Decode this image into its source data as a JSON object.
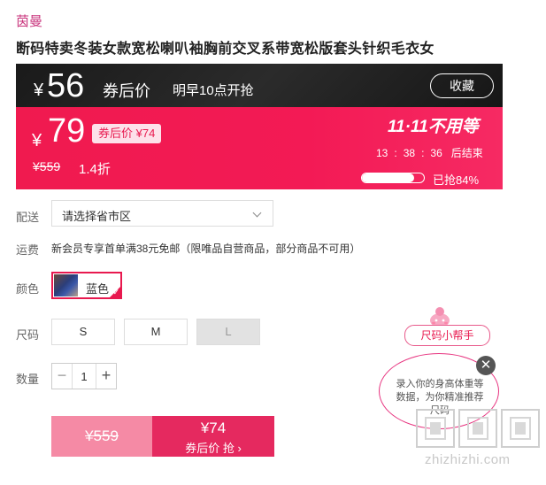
{
  "product": {
    "brand": "茵曼",
    "title": "断码特卖冬装女款宽松喇叭袖胸前交叉系带宽松版套头针织毛衣女"
  },
  "promo": {
    "currency": "¥",
    "coupon_price": "56",
    "coupon_price_label": "券后价",
    "sale_note": "明早10点开抢",
    "favorite_label": "收藏",
    "original_price_value": "79",
    "coupon_tag": "券后价 ¥74",
    "list_price": "¥559",
    "discount": "1.4折",
    "event_title": "11·11不用等",
    "countdown": {
      "h": "13",
      "m": "38",
      "s": "36",
      "suffix": "后结束",
      "sep": ":"
    },
    "claimed_label": "已抢84%",
    "claimed_fraction": 0.84
  },
  "shipping": {
    "label": "配送",
    "placeholder": "请选择省市区",
    "fee_label": "运费",
    "fee_text": "新会员专享首单满38元免邮（限唯品自营商品，部分商品不可用）"
  },
  "color": {
    "label": "颜色",
    "options": [
      {
        "name": "蓝色",
        "selected": true
      }
    ],
    "check_icon": "checkmark-icon"
  },
  "size": {
    "label": "尺码",
    "options": [
      {
        "name": "S",
        "available": true
      },
      {
        "name": "M",
        "available": true
      },
      {
        "name": "L",
        "available": false
      }
    ]
  },
  "quantity": {
    "label": "数量",
    "value": "1",
    "minus": "−",
    "plus": "+"
  },
  "buy": {
    "list_price": "¥559",
    "coupon_price": "¥74",
    "action": "券后价 抢 ›"
  },
  "size_helper": {
    "pill": "尺码小帮手",
    "bubble": "录入你的身高体重等数据，为你精准推荐尺码",
    "close": "✕"
  },
  "watermark": {
    "text": "zhizhizhi.com"
  },
  "colors": {
    "accent": "#e8194f",
    "brand_text": "#c9357d",
    "banner_dark": "#1b1b1b"
  }
}
